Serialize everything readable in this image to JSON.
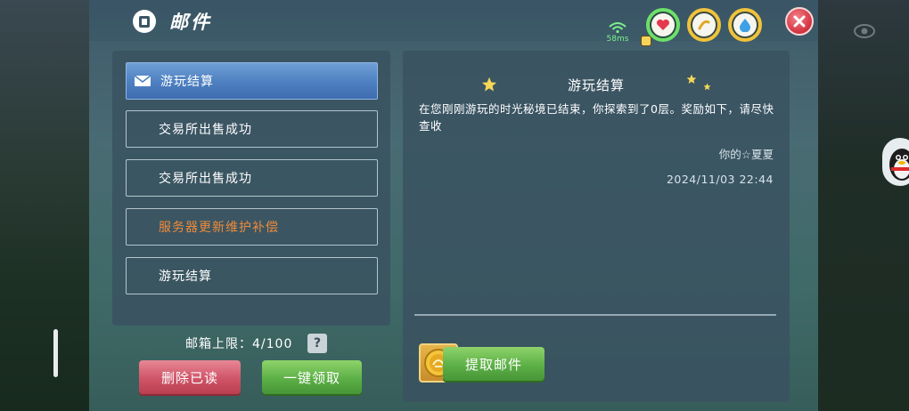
{
  "window": {
    "title": "邮件"
  },
  "status": {
    "network_label": "58ms",
    "colors": {
      "health": "#6de06a",
      "food": "#f0c33c",
      "water": "#f0c33c",
      "close": "#d93b48"
    }
  },
  "mail_list": {
    "items": [
      {
        "label": "游玩结算",
        "selected": true,
        "icon": "envelope-icon"
      },
      {
        "label": "交易所出售成功",
        "selected": false
      },
      {
        "label": "交易所出售成功",
        "selected": false
      },
      {
        "label": "服务器更新维护补偿",
        "selected": false,
        "color": "#f08a3a"
      },
      {
        "label": "游玩结算",
        "selected": false
      }
    ],
    "capacity": "邮箱上限：4/100",
    "help": "?"
  },
  "actions": {
    "delete_read": "删除已读",
    "claim_all": "一键领取"
  },
  "detail": {
    "title": "游玩结算",
    "body": "在您刚刚游玩的时光秘境已结束，你探索到了0层。奖励如下，请尽快查收",
    "sender": "你的☆夏夏",
    "date": "2024/11/03 22:44",
    "reward_count": "1",
    "retrieve": "提取邮件"
  }
}
